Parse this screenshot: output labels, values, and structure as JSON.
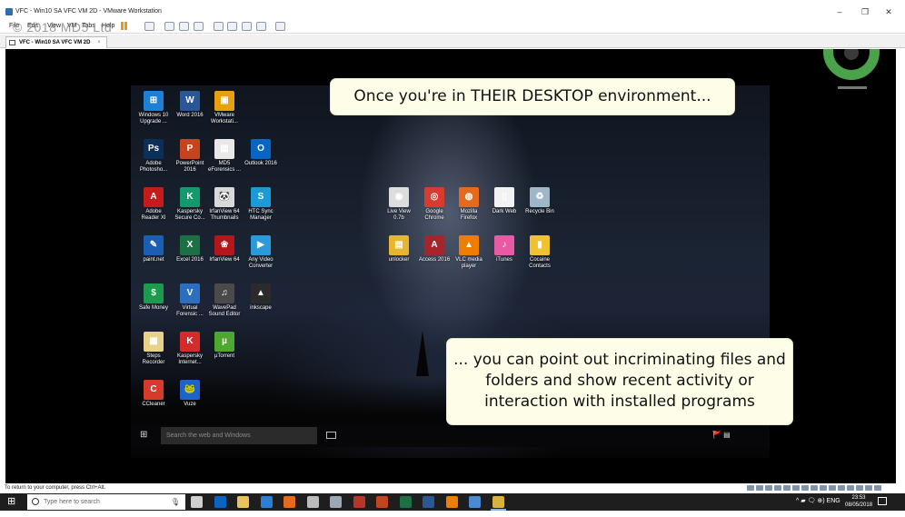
{
  "window": {
    "title": "VFC - Win10 SA VFC VM 2D - VMware Workstation",
    "controls": {
      "minimize": "–",
      "maximize": "❐",
      "close": "✕"
    }
  },
  "menubar": {
    "file": "File",
    "edit": "Edit",
    "view": "View",
    "vm": "VM",
    "tabs": "Tabs",
    "help": "Help"
  },
  "watermark": "© 2018 MD5 Ltd",
  "tab": {
    "label": "VFC - Win10 SA VFC VM 2D",
    "close": "×"
  },
  "desktop_icons": [
    {
      "label": "Windows 10\nUpgrade ...",
      "color": "#1e7fd6",
      "glyph": "⊞"
    },
    {
      "label": "Word 2016",
      "color": "#2b5797",
      "glyph": "W"
    },
    {
      "label": "VMware\nWorkstati...",
      "color": "#e6a10d",
      "glyph": "▣"
    },
    {
      "label": "Adobe\nPhotosho...",
      "color": "#0b2f57",
      "glyph": "Ps"
    },
    {
      "label": "PowerPoint\n2016",
      "color": "#c4441f",
      "glyph": "P"
    },
    {
      "label": "MD5\neForensics ...",
      "color": "#e8e8e8",
      "glyph": "▤"
    },
    {
      "label": "Outlook 2016",
      "color": "#0a64c2",
      "glyph": "O"
    },
    {
      "label": "Adobe\nReader XI",
      "color": "#c61b1b",
      "glyph": "A"
    },
    {
      "label": "Kaspersky\nSecure Co...",
      "color": "#129a6c",
      "glyph": "K"
    },
    {
      "label": "IrfanView 64\nThumbnails",
      "color": "#d9d9d9",
      "glyph": "🐼"
    },
    {
      "label": "HTC Sync\nManager",
      "color": "#1b9ad6",
      "glyph": "S"
    },
    {
      "label": "paint.net",
      "color": "#1c5db5",
      "glyph": "✎"
    },
    {
      "label": "Excel 2016",
      "color": "#1d7044",
      "glyph": "X"
    },
    {
      "label": "IrfanView 64",
      "color": "#b3161b",
      "glyph": "❀"
    },
    {
      "label": "Any Video\nConverter",
      "color": "#2a9bd8",
      "glyph": "▶"
    },
    {
      "label": "Safe Money",
      "color": "#1b9b4b",
      "glyph": "$"
    },
    {
      "label": "Virtual\nForensic ...",
      "color": "#2d6fbf",
      "glyph": "V"
    },
    {
      "label": "WavePad\nSound Editor",
      "color": "#4a4a4a",
      "glyph": "♫"
    },
    {
      "label": "inkscape",
      "color": "#2b2b2b",
      "glyph": "▲"
    },
    {
      "label": "Steps\nRecorder",
      "color": "#e8d289",
      "glyph": "▦"
    },
    {
      "label": "Kaspersky\nInternet...",
      "color": "#d42b2b",
      "glyph": "K"
    },
    {
      "label": "µTorrent",
      "color": "#4ea82e",
      "glyph": "µ"
    },
    {
      "label": "CCleaner",
      "color": "#d63b2a",
      "glyph": "C"
    },
    {
      "label": "Vuze",
      "color": "#1d63c9",
      "glyph": "🐸"
    },
    {
      "label": "Live View\n0.7b",
      "color": "#dddddd",
      "glyph": "◉"
    },
    {
      "label": "Google\nChrome",
      "color": "#d93b2f",
      "glyph": "◎"
    },
    {
      "label": "Mozilla\nFirefox",
      "color": "#e56a1c",
      "glyph": "◍"
    },
    {
      "label": "Dark Web",
      "color": "#f2f2f2",
      "glyph": "▯"
    },
    {
      "label": "Recycle Bin",
      "color": "#9fb6c9",
      "glyph": "♻"
    },
    {
      "label": "unlocker",
      "color": "#e8b530",
      "glyph": "▤"
    },
    {
      "label": "Access 2016",
      "color": "#a4262c",
      "glyph": "A"
    },
    {
      "label": "VLC media\nplayer",
      "color": "#ef7d00",
      "glyph": "▲"
    },
    {
      "label": "iTunes",
      "color": "#e85aa6",
      "glyph": "♪"
    },
    {
      "label": "Cocaine\nContacts",
      "color": "#f0c230",
      "glyph": "▮"
    }
  ],
  "callouts": {
    "top": "Once you're in THEIR DESKTOP environment...",
    "bottom": "... you can point out incriminating files and\nfolders and show recent activity or\ninteraction with installed programs"
  },
  "vm_taskbar": {
    "search_placeholder": "Search the web and Windows",
    "tray": "🚩 ▤"
  },
  "status_bar": {
    "text": "To return to your computer, press Ctrl+Alt."
  },
  "host_taskbar": {
    "search_placeholder": "Type here to search",
    "apps": [
      {
        "name": "task-view",
        "color": "#cfcfcf"
      },
      {
        "name": "outlook",
        "color": "#0a64c2"
      },
      {
        "name": "file-explorer",
        "color": "#e8c25a"
      },
      {
        "name": "edge",
        "color": "#2a7fd4"
      },
      {
        "name": "firefox",
        "color": "#e56a1c"
      },
      {
        "name": "calculator",
        "color": "#bbbbbb"
      },
      {
        "name": "snipping",
        "color": "#9aa7b5"
      },
      {
        "name": "forensics",
        "color": "#b8352a"
      },
      {
        "name": "powerpoint",
        "color": "#c4441f"
      },
      {
        "name": "excel",
        "color": "#1d7044"
      },
      {
        "name": "word",
        "color": "#2b5797"
      },
      {
        "name": "vlc",
        "color": "#ef7d00"
      },
      {
        "name": "network",
        "color": "#4b8ad0"
      },
      {
        "name": "vmware",
        "color": "#d9b23a"
      }
    ],
    "tray": "^ ▰ 🗨 ⊕) ENG",
    "time": "23:53",
    "date": "08/05/2018"
  },
  "colors": {
    "callout_bg": "#fdfde8",
    "logo_green": "#4aa24a"
  }
}
